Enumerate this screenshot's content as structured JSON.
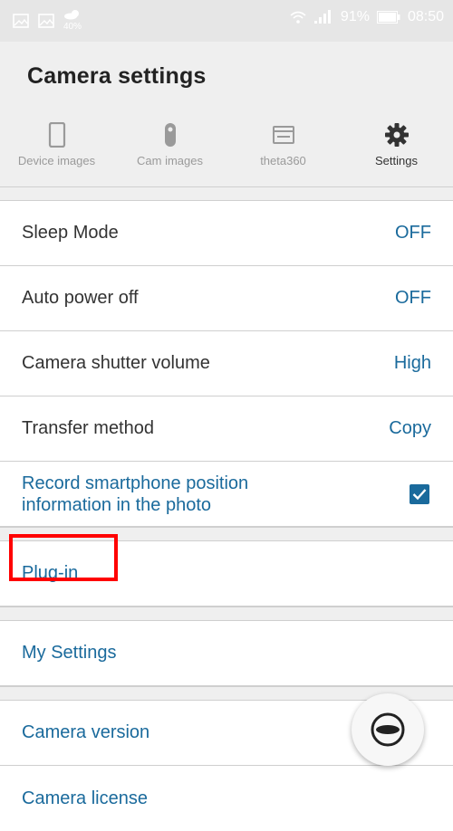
{
  "status_bar": {
    "weather_percent": "40%",
    "battery": "91%",
    "time": "08:50",
    "icons": [
      "image-icon",
      "image-icon",
      "weather-icon",
      "wifi-icon",
      "signal-icon",
      "battery-icon"
    ]
  },
  "header": {
    "title": "Camera settings"
  },
  "tabs": [
    {
      "label": "Device images",
      "icon": "phone-icon",
      "active": false
    },
    {
      "label": "Cam images",
      "icon": "camera-icon",
      "active": false
    },
    {
      "label": "theta360",
      "icon": "window-icon",
      "active": false
    },
    {
      "label": "Settings",
      "icon": "gear-icon",
      "active": true
    }
  ],
  "settings": {
    "sleep_mode": {
      "label": "Sleep Mode",
      "value": "OFF"
    },
    "auto_power_off": {
      "label": "Auto power off",
      "value": "OFF"
    },
    "shutter_volume": {
      "label": "Camera shutter volume",
      "value": "High"
    },
    "transfer_method": {
      "label": "Transfer method",
      "value": "Copy"
    },
    "record_position": {
      "label_line1": "Record smartphone position",
      "label_line2": "information in the photo",
      "checked": true
    }
  },
  "links": {
    "plugin": "Plug-in",
    "my_settings": "My Settings",
    "camera_version": "Camera version",
    "camera_license": "Camera license"
  },
  "colors": {
    "accent": "#1a6a9c",
    "highlight": "#ff0000",
    "status_bar": "#e6e6e6"
  }
}
